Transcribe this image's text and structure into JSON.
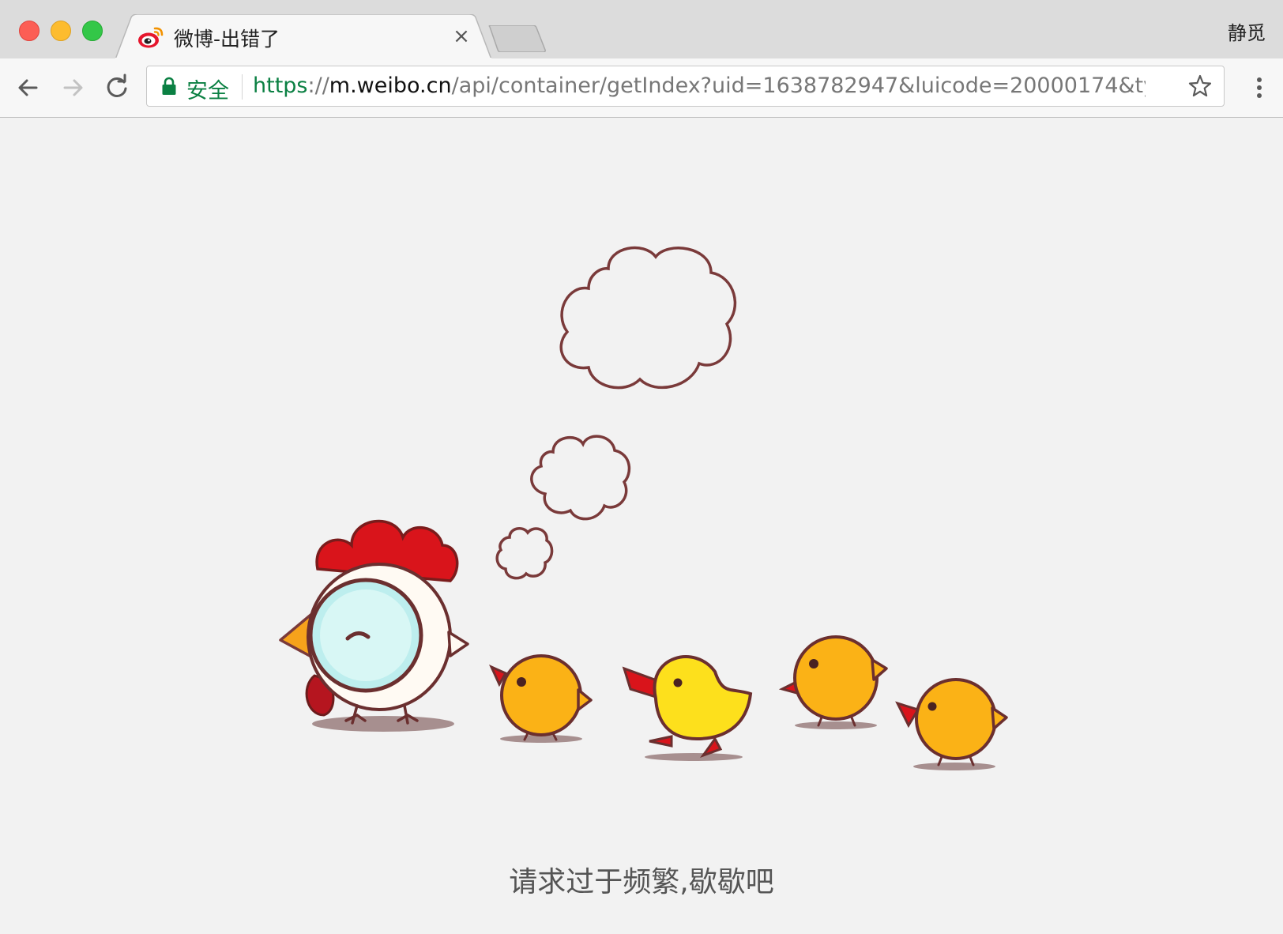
{
  "browser": {
    "profile_name": "静觅",
    "tab": {
      "title": "微博-出错了",
      "close_glyph": "×",
      "favicon": "weibo-logo-icon"
    },
    "address_bar": {
      "secure_label": "安全",
      "url_scheme": "https",
      "url_separator": "://",
      "url_host": "m.weibo.cn",
      "url_path": "/api/container/getIndex?uid=1638782947&luicode=20000174&type..."
    },
    "icons": [
      "back-icon",
      "forward-icon",
      "reload-icon",
      "lock-icon",
      "star-icon",
      "menu-icon"
    ]
  },
  "page": {
    "error_message": "请求过于频繁,歇歇吧",
    "illustration": "hen-with-magnifier-and-chicks"
  },
  "colors": {
    "secure_green": "#0b8043",
    "weibo_red": "#e6162d",
    "chick_orange": "#fbb216",
    "chick_yellow": "#fde01c",
    "comb_red": "#d9141b",
    "outline": "#6b2f2f",
    "page_bg": "#f2f2f2"
  }
}
